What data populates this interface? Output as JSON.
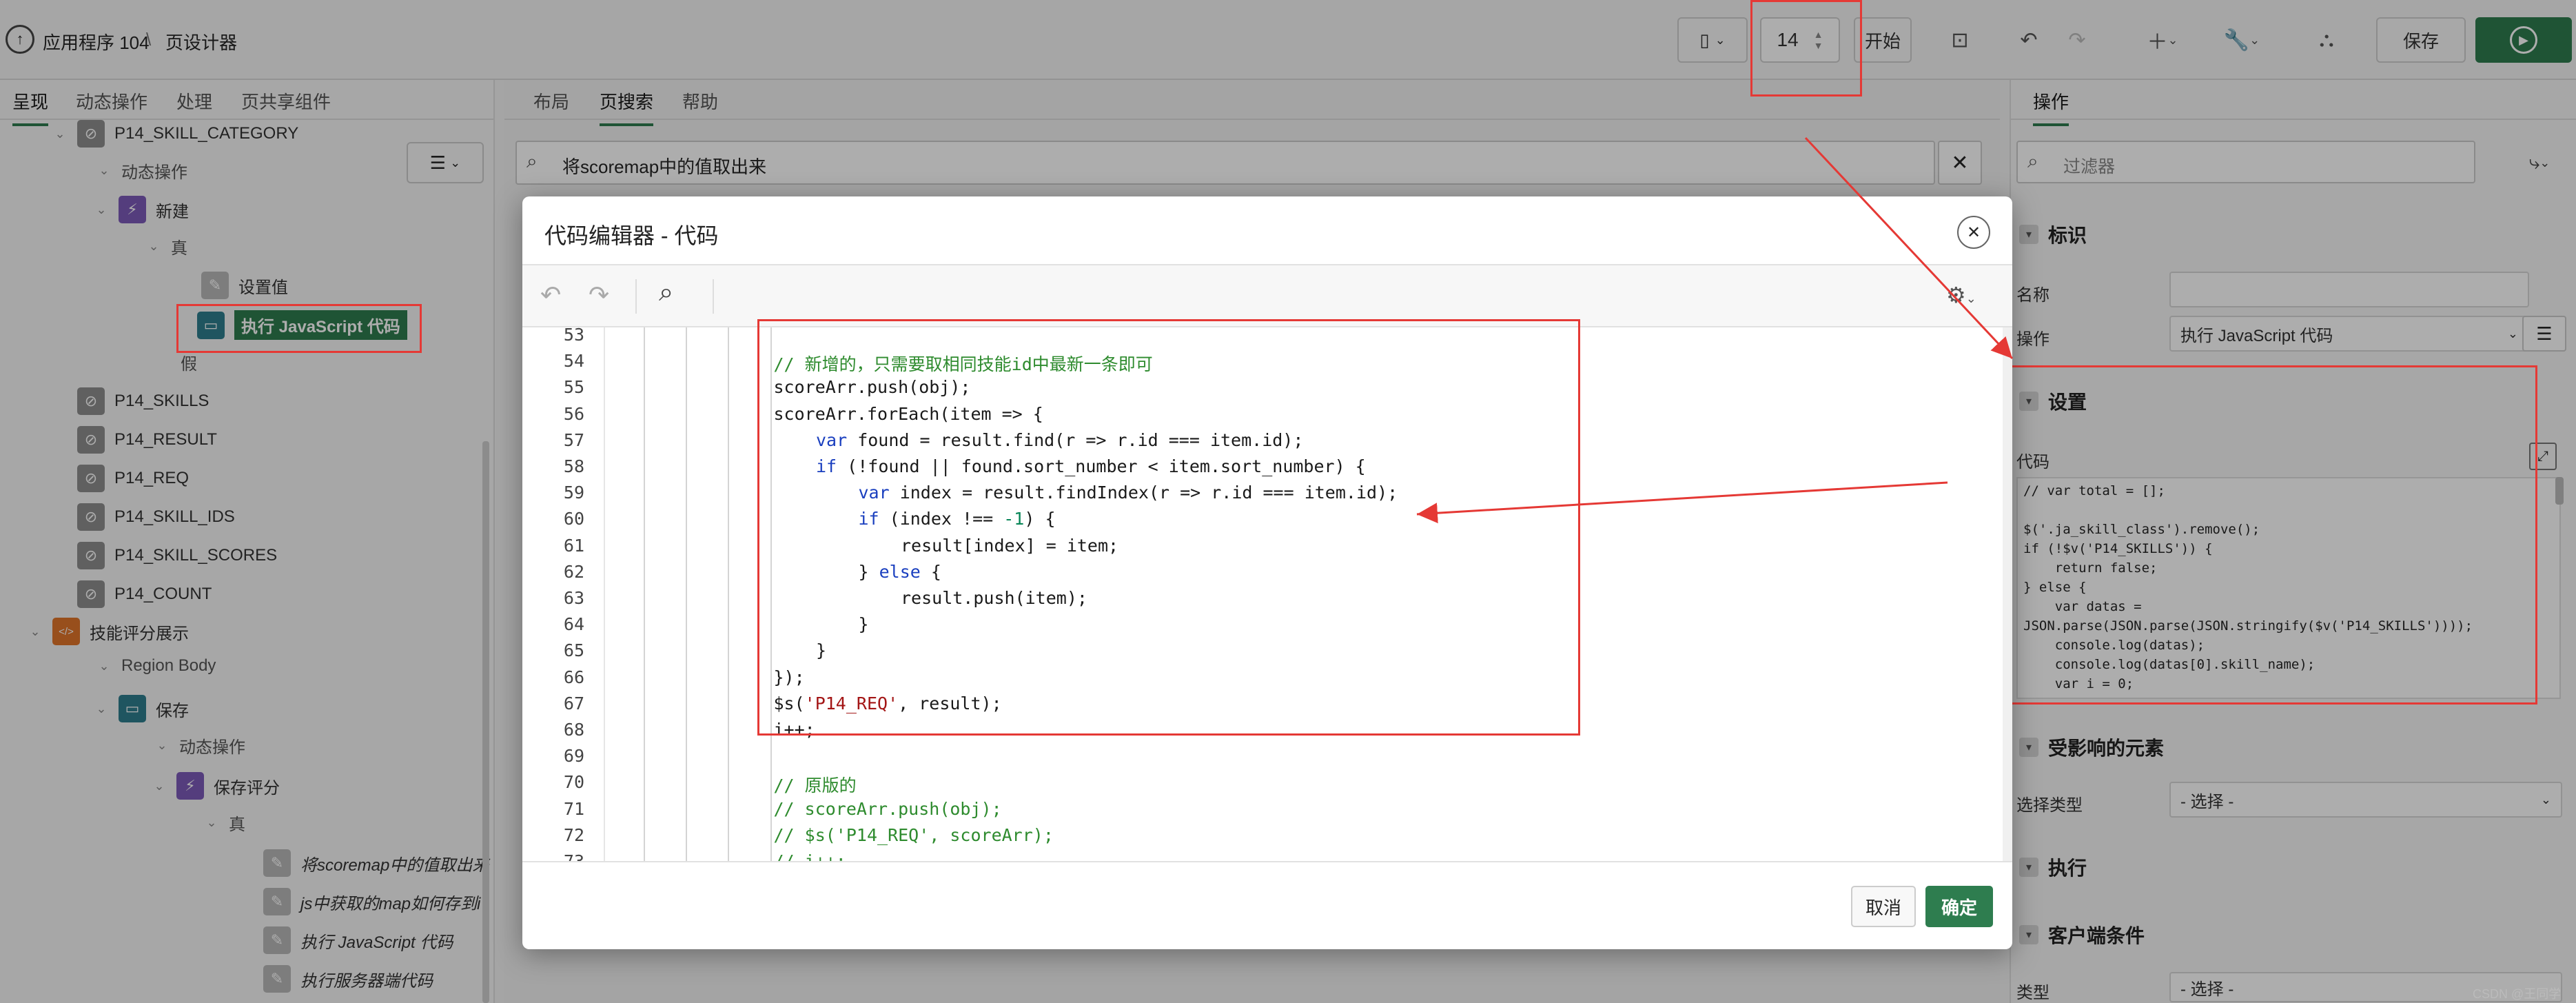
{
  "topbar": {
    "app_name": "应用程序 104",
    "separator": "\\",
    "page_designer": "页设计器",
    "page_number": "14",
    "start_label": "开始",
    "save_label": "保存"
  },
  "left_panel": {
    "tabs": [
      "呈现",
      "动态操作",
      "处理",
      "页共享组件"
    ],
    "tree": [
      {
        "label": "P14_SKILL_CATEGORY",
        "icon": "item-icon"
      },
      {
        "label": "动态操作",
        "icon": ""
      },
      {
        "label": "新建",
        "icon": "lightning-icon"
      },
      {
        "label": "真",
        "icon": ""
      },
      {
        "label": "设置值",
        "icon": "edit-icon"
      },
      {
        "label": "执行 JavaScript 代码",
        "icon": "script-icon"
      },
      {
        "label": "假",
        "icon": ""
      },
      {
        "label": "P14_SKILLS",
        "icon": "hidden-item-icon"
      },
      {
        "label": "P14_RESULT",
        "icon": "hidden-item-icon"
      },
      {
        "label": "P14_REQ",
        "icon": "hidden-item-icon"
      },
      {
        "label": "P14_SKILL_IDS",
        "icon": "hidden-item-icon"
      },
      {
        "label": "P14_SKILL_SCORES",
        "icon": "hidden-item-icon"
      },
      {
        "label": "P14_COUNT",
        "icon": "hidden-item-icon"
      },
      {
        "label": "技能评分展示",
        "icon": "code-region-icon"
      },
      {
        "label": "Region Body",
        "icon": ""
      },
      {
        "label": "保存",
        "icon": "button-icon"
      },
      {
        "label": "动态操作",
        "icon": ""
      },
      {
        "label": "保存评分",
        "icon": "lightning-icon"
      },
      {
        "label": "真",
        "icon": ""
      },
      {
        "label": "将scoremap中的值取出来",
        "icon": "action-icon"
      },
      {
        "label": "js中获取的map如何存到i",
        "icon": "action-icon"
      },
      {
        "label": "执行 JavaScript 代码",
        "icon": "action-icon"
      },
      {
        "label": "执行服务器端代码",
        "icon": "gear-action-icon"
      }
    ]
  },
  "center_panel": {
    "tabs": [
      "布局",
      "页搜索",
      "帮助"
    ],
    "search_value": "将scoremap中的值取出来"
  },
  "modal": {
    "title": "代码编辑器 - 代码",
    "cancel_label": "取消",
    "ok_label": "确定",
    "code_lines": [
      {
        "num": "53",
        "indent": 0,
        "segments": []
      },
      {
        "num": "54",
        "indent": 4,
        "segments": [
          {
            "t": "// 新增的，只需要取相同技能id中最新一条即可",
            "c": "cm"
          }
        ]
      },
      {
        "num": "55",
        "indent": 4,
        "segments": [
          {
            "t": "scoreArr.push(obj);",
            "c": ""
          }
        ]
      },
      {
        "num": "56",
        "indent": 4,
        "segments": [
          {
            "t": "scoreArr.forEach(item => {",
            "c": ""
          }
        ]
      },
      {
        "num": "57",
        "indent": 5,
        "segments": [
          {
            "t": "var",
            "c": "kw"
          },
          {
            "t": " found = result.find(r => r.id === item.id);",
            "c": ""
          }
        ]
      },
      {
        "num": "58",
        "indent": 5,
        "segments": [
          {
            "t": "if",
            "c": "kw"
          },
          {
            "t": " (!found || found.sort_number < item.sort_number) {",
            "c": ""
          }
        ]
      },
      {
        "num": "59",
        "indent": 6,
        "segments": [
          {
            "t": "var",
            "c": "kw"
          },
          {
            "t": " index = result.findIndex(r => r.id === item.id);",
            "c": ""
          }
        ]
      },
      {
        "num": "60",
        "indent": 6,
        "segments": [
          {
            "t": "if",
            "c": "kw"
          },
          {
            "t": " (index !== ",
            "c": ""
          },
          {
            "t": "-1",
            "c": "num"
          },
          {
            "t": ") {",
            "c": ""
          }
        ]
      },
      {
        "num": "61",
        "indent": 7,
        "segments": [
          {
            "t": "result[index] = item;",
            "c": ""
          }
        ]
      },
      {
        "num": "62",
        "indent": 6,
        "segments": [
          {
            "t": "} ",
            "c": ""
          },
          {
            "t": "else",
            "c": "kw"
          },
          {
            "t": " {",
            "c": ""
          }
        ]
      },
      {
        "num": "63",
        "indent": 7,
        "segments": [
          {
            "t": "result.push(item);",
            "c": ""
          }
        ]
      },
      {
        "num": "64",
        "indent": 6,
        "segments": [
          {
            "t": "}",
            "c": ""
          }
        ]
      },
      {
        "num": "65",
        "indent": 5,
        "segments": [
          {
            "t": "}",
            "c": ""
          }
        ]
      },
      {
        "num": "66",
        "indent": 4,
        "segments": [
          {
            "t": "});",
            "c": ""
          }
        ]
      },
      {
        "num": "67",
        "indent": 4,
        "segments": [
          {
            "t": "$s(",
            "c": ""
          },
          {
            "t": "'P14_REQ'",
            "c": "str"
          },
          {
            "t": ", result);",
            "c": ""
          }
        ]
      },
      {
        "num": "68",
        "indent": 4,
        "segments": [
          {
            "t": "i++;",
            "c": ""
          }
        ]
      },
      {
        "num": "69",
        "indent": 4,
        "segments": []
      },
      {
        "num": "70",
        "indent": 4,
        "segments": [
          {
            "t": "// 原版的",
            "c": "cm"
          }
        ]
      },
      {
        "num": "71",
        "indent": 4,
        "segments": [
          {
            "t": "// scoreArr.push(obj);",
            "c": "cm"
          }
        ]
      },
      {
        "num": "72",
        "indent": 4,
        "segments": [
          {
            "t": "// $s('P14_REQ', scoreArr);",
            "c": "cm"
          }
        ]
      },
      {
        "num": "73",
        "indent": 4,
        "segments": [
          {
            "t": "// i++;",
            "c": "cm"
          }
        ]
      },
      {
        "num": "74",
        "indent": 0,
        "segments": []
      }
    ]
  },
  "right_panel": {
    "tab": "操作",
    "filter_placeholder": "过滤器",
    "section_identity": "标识",
    "name_label": "名称",
    "action_label": "操作",
    "action_value": "执行 JavaScript 代码",
    "section_settings": "设置",
    "code_label": "代码",
    "code_preview": [
      "// var total = [];",
      "",
      "$('.ja_skill_class').remove();",
      "if (!$v('P14_SKILLS')) {",
      "    return false;",
      "} else {",
      "    var datas =",
      "JSON.parse(JSON.parse(JSON.stringify($v('P14_SKILLS'))));",
      "    console.log(datas);",
      "    console.log(datas[0].skill_name);",
      "    var i = 0;"
    ],
    "section_affected": "受影响的元素",
    "select_type_label": "选择类型",
    "select_placeholder": "- 选择 -",
    "section_execute": "执行",
    "section_client": "客户端条件",
    "type_label": "类型",
    "type_value": "- 选择 -"
  },
  "watermark": "CSDN @王同学Bo",
  "colors": {
    "accent": "#2e7d4f",
    "annotation_red": "#e53935"
  }
}
